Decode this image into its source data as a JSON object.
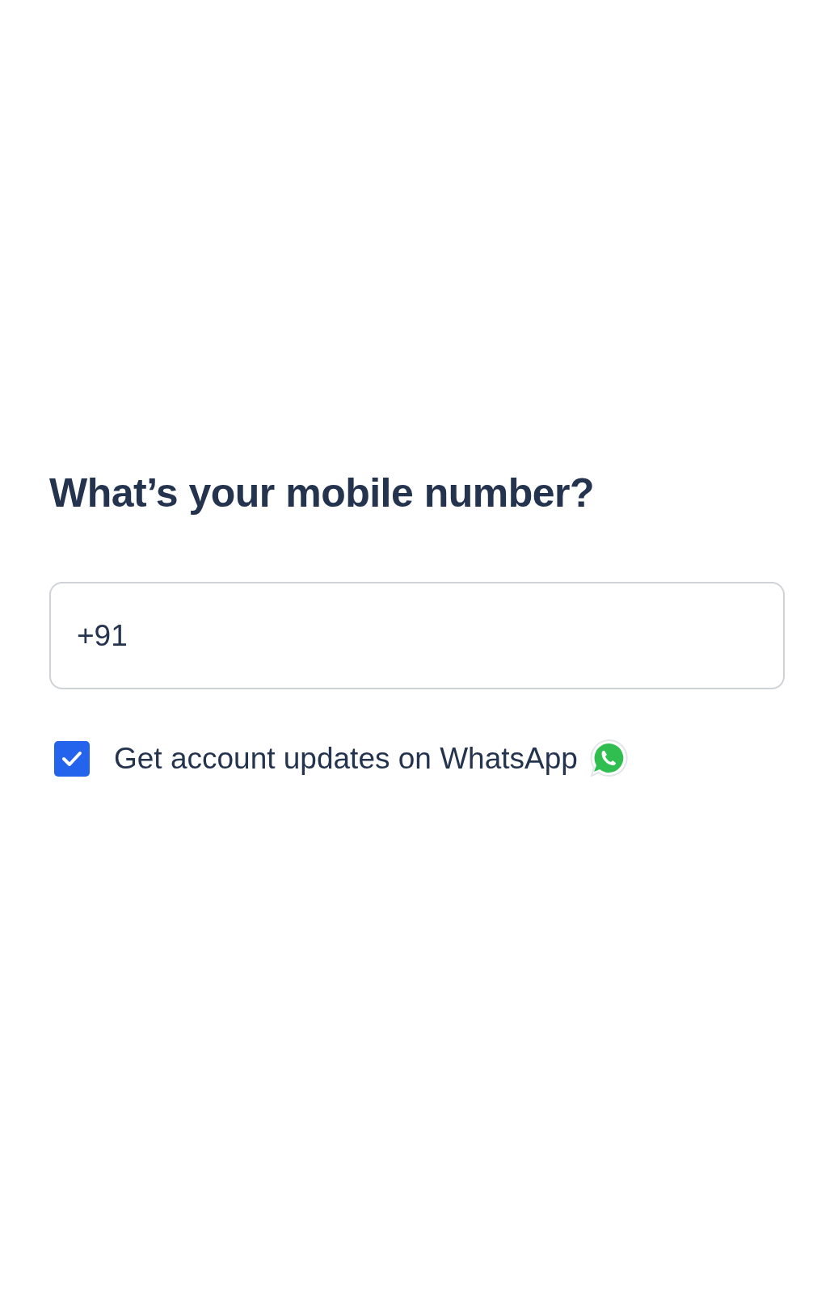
{
  "heading": "What’s your mobile number?",
  "phone_field": {
    "value": "+91"
  },
  "whatsapp_option": {
    "label": "Get account updates on WhatsApp",
    "checked": true
  }
}
